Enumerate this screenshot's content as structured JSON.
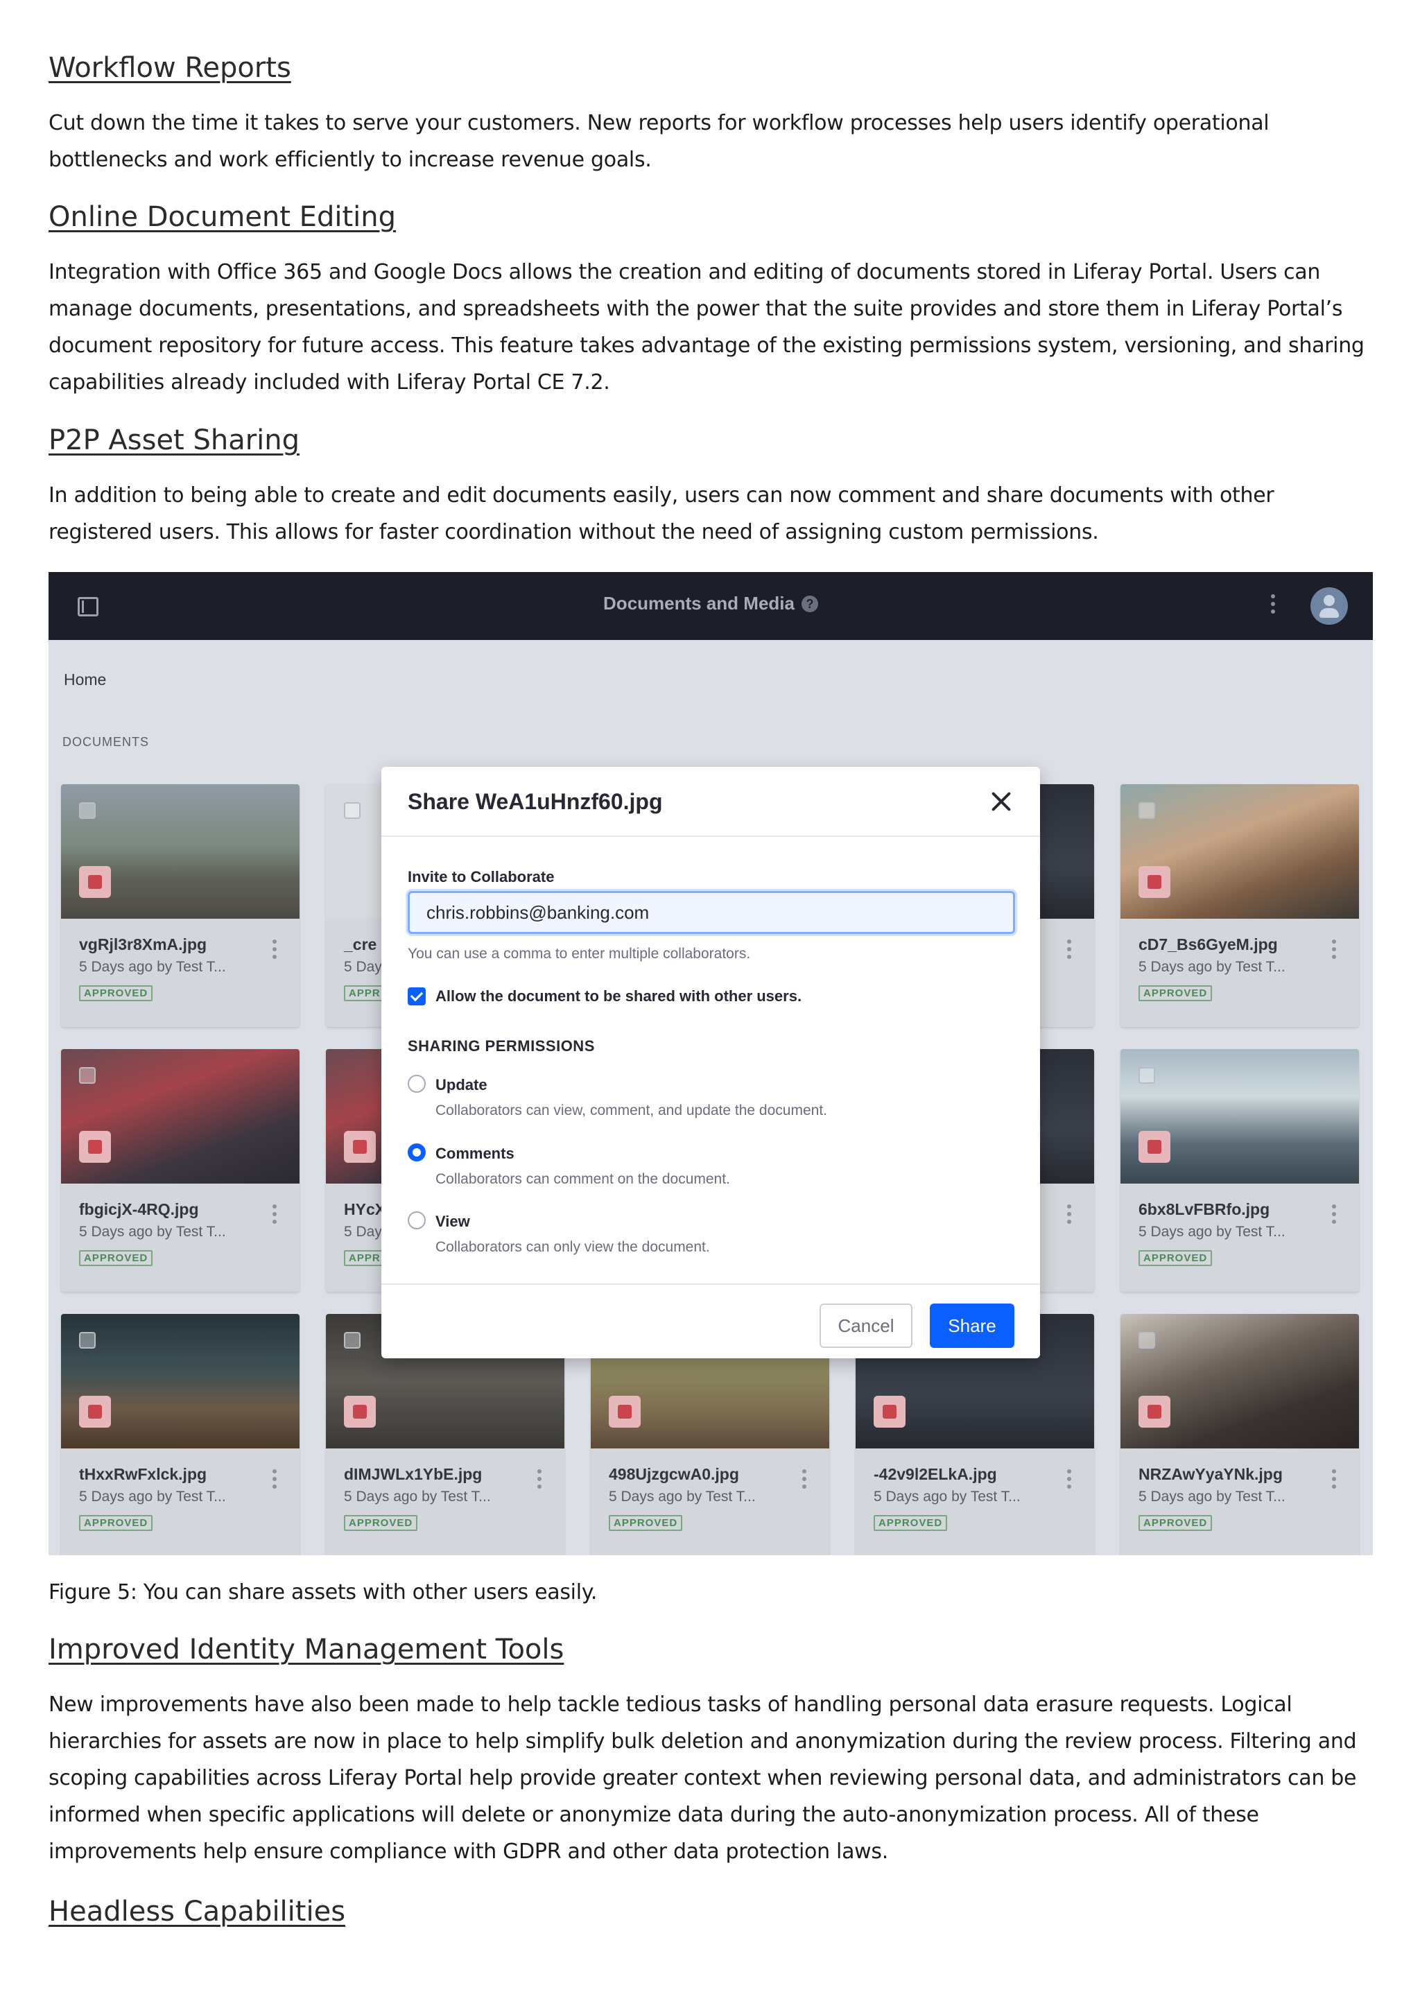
{
  "sections": [
    {
      "heading": "Workflow Reports",
      "paragraph": "Cut down the time it takes to serve your customers. New reports for workflow processes help users identify operational bottlenecks and work efficiently to increase revenue goals."
    },
    {
      "heading": "Online Document Editing",
      "paragraph": "Integration with Office 365 and Google Docs allows the creation and editing of documents stored in Liferay Portal. Users can manage documents, presentations, and spreadsheets with the power that the suite provides and store them in Liferay Portal’s document repository for future access. This feature takes advantage of the existing permissions system, versioning, and sharing capabilities already included with Liferay Portal CE 7.2."
    },
    {
      "heading": "P2P Asset Sharing",
      "paragraph": "In addition to being able to create and edit documents easily, users can now comment and share documents with other registered users. This allows for faster coordination without the need of assigning custom permissions."
    },
    {
      "heading": "Improved Identity Management Tools",
      "paragraph": "New improvements have also been made to help tackle tedious tasks of handling personal data erasure requests. Logical hierarchies for assets are now in place to help simplify bulk deletion and anonymization during the review process. Filtering and scoping capabilities across Liferay Portal help provide greater context when reviewing personal data, and administrators can be informed when specific applications will delete or anonymize data during the auto-anonymization process. All of these improvements help ensure compliance with GDPR and other data protection laws."
    },
    {
      "heading": "Headless Capabilities",
      "paragraph": ""
    }
  ],
  "figure": {
    "caption": "Figure 5: You can share assets with other users easily.",
    "app": {
      "title": "Documents and Media",
      "help_glyph": "?",
      "breadcrumb": "Home",
      "section_label": "DOCUMENTS",
      "cards": [
        {
          "name": "vgRjl3r8XmA.jpg",
          "meta": "5 Days ago by Test T...",
          "status": "APPROVED"
        },
        {
          "name": "_cre",
          "meta": "5 Day",
          "status": "APPR"
        },
        {
          "name": "cD7_Bs6GyeM.jpg",
          "meta": "5 Days ago by Test T...",
          "status": "APPROVED"
        },
        {
          "name": "fbgicjX-4RQ.jpg",
          "meta": "5 Days ago by Test T...",
          "status": "APPROVED"
        },
        {
          "name": "HYcX",
          "meta": "5 Day",
          "status": "APPR"
        },
        {
          "name": "6bx8LvFBRfo.jpg",
          "meta": "5 Days ago by Test T...",
          "status": "APPROVED"
        },
        {
          "name": "tHxxRwFxlck.jpg",
          "meta": "5 Days ago by Test T...",
          "status": "APPROVED"
        },
        {
          "name": "dIMJWLx1YbE.jpg",
          "meta": "5 Days ago by Test T...",
          "status": "APPROVED"
        },
        {
          "name": "498UjzgcwA0.jpg",
          "meta": "5 Days ago by Test T...",
          "status": "APPROVED"
        },
        {
          "name": "-42v9l2ELkA.jpg",
          "meta": "5 Days ago by Test T...",
          "status": "APPROVED"
        },
        {
          "name": "NRZAwYyaYNk.jpg",
          "meta": "5 Days ago by Test T...",
          "status": "APPROVED"
        }
      ],
      "modal": {
        "title": "Share WeA1uHnzf60.jpg",
        "invite_label": "Invite to Collaborate",
        "invite_value": "chris.robbins@banking.com",
        "help_text": "You can use a comma to enter multiple collaborators.",
        "allow_share_label": "Allow the document to be shared with other users.",
        "allow_share_checked": true,
        "permissions_heading": "SHARING PERMISSIONS",
        "options": [
          {
            "label": "Update",
            "desc": "Collaborators can view, comment, and update the document.",
            "selected": false
          },
          {
            "label": "Comments",
            "desc": "Collaborators can comment on the document.",
            "selected": true
          },
          {
            "label": "View",
            "desc": "Collaborators can only view the document.",
            "selected": false
          }
        ],
        "cancel_label": "Cancel",
        "share_label": "Share"
      }
    }
  },
  "colors": {
    "topbar": "#1c1f29",
    "primary": "#0b5fff",
    "approved": "#4c8a5a"
  }
}
